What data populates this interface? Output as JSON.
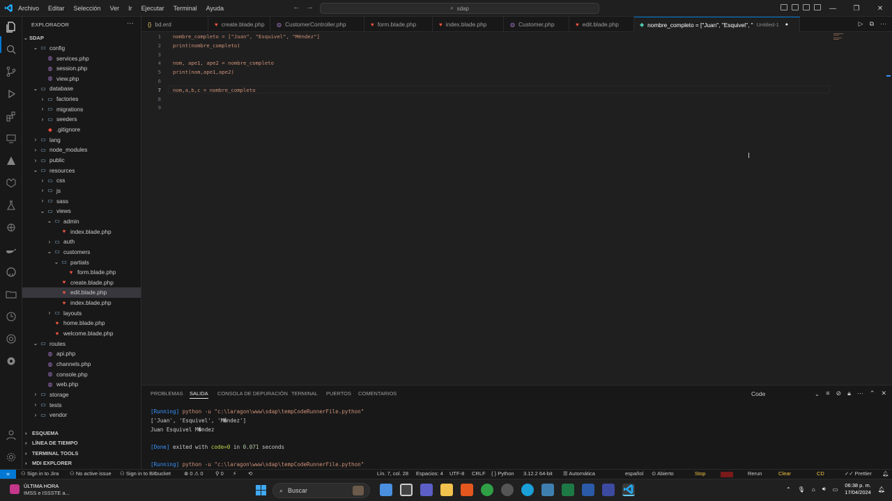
{
  "titlebar": {
    "menu": [
      "Archivo",
      "Editar",
      "Selección",
      "Ver",
      "Ir",
      "Ejecutar",
      "Terminal",
      "Ayuda"
    ],
    "search_text": "sdap"
  },
  "sidebar": {
    "title": "EXPLORADOR",
    "root": "SDAP",
    "tree": [
      {
        "label": "config",
        "depth": 1,
        "kind": "folder",
        "open": true
      },
      {
        "label": "services.php",
        "depth": 2,
        "kind": "php"
      },
      {
        "label": "session.php",
        "depth": 2,
        "kind": "php"
      },
      {
        "label": "view.php",
        "depth": 2,
        "kind": "php"
      },
      {
        "label": "database",
        "depth": 1,
        "kind": "folder",
        "open": true
      },
      {
        "label": "factories",
        "depth": 2,
        "kind": "folder",
        "open": false
      },
      {
        "label": "migrations",
        "depth": 2,
        "kind": "folder",
        "open": false
      },
      {
        "label": "seeders",
        "depth": 2,
        "kind": "folder",
        "open": false
      },
      {
        "label": ".gitignore",
        "depth": 2,
        "kind": "git"
      },
      {
        "label": "lang",
        "depth": 1,
        "kind": "folder",
        "open": false
      },
      {
        "label": "node_modules",
        "depth": 1,
        "kind": "folder",
        "open": false
      },
      {
        "label": "public",
        "depth": 1,
        "kind": "folder",
        "open": false
      },
      {
        "label": "resources",
        "depth": 1,
        "kind": "folder",
        "open": true
      },
      {
        "label": "css",
        "depth": 2,
        "kind": "folder",
        "open": false
      },
      {
        "label": "js",
        "depth": 2,
        "kind": "folder",
        "open": false
      },
      {
        "label": "sass",
        "depth": 2,
        "kind": "folder",
        "open": false
      },
      {
        "label": "views",
        "depth": 2,
        "kind": "folder",
        "open": true
      },
      {
        "label": "admin",
        "depth": 3,
        "kind": "folder",
        "open": true
      },
      {
        "label": "index.blade.php",
        "depth": 4,
        "kind": "blade"
      },
      {
        "label": "auth",
        "depth": 3,
        "kind": "folder",
        "open": false
      },
      {
        "label": "customers",
        "depth": 3,
        "kind": "folder",
        "open": true
      },
      {
        "label": "partials",
        "depth": 4,
        "kind": "folder",
        "open": true
      },
      {
        "label": "form.blade.php",
        "depth": 5,
        "kind": "blade"
      },
      {
        "label": "create.blade.php",
        "depth": 4,
        "kind": "blade"
      },
      {
        "label": "edit.blade.php",
        "depth": 4,
        "kind": "blade",
        "selected": true
      },
      {
        "label": "index.blade.php",
        "depth": 4,
        "kind": "blade"
      },
      {
        "label": "layouts",
        "depth": 3,
        "kind": "folder",
        "open": false
      },
      {
        "label": "home.blade.php",
        "depth": 3,
        "kind": "blade"
      },
      {
        "label": "welcome.blade.php",
        "depth": 3,
        "kind": "blade"
      },
      {
        "label": "routes",
        "depth": 1,
        "kind": "folder",
        "open": true
      },
      {
        "label": "api.php",
        "depth": 2,
        "kind": "php"
      },
      {
        "label": "channels.php",
        "depth": 2,
        "kind": "php"
      },
      {
        "label": "console.php",
        "depth": 2,
        "kind": "php"
      },
      {
        "label": "web.php",
        "depth": 2,
        "kind": "php"
      },
      {
        "label": "storage",
        "depth": 1,
        "kind": "folder",
        "open": false
      },
      {
        "label": "tests",
        "depth": 1,
        "kind": "folder",
        "open": false
      },
      {
        "label": "vendor",
        "depth": 1,
        "kind": "folder",
        "open": false
      }
    ],
    "sections": [
      "ESQUEMA",
      "LÍNEA DE TIEMPO",
      "TERMINAL TOOLS",
      "MDI EXPLORER"
    ]
  },
  "tabs": [
    {
      "label": "bd.erd",
      "icon": "{}"
    },
    {
      "label": "create.blade.php",
      "icon": "blade"
    },
    {
      "label": "CustomerController.php",
      "icon": "php"
    },
    {
      "label": "form.blade.php",
      "icon": "blade"
    },
    {
      "label": "index.blade.php",
      "icon": "blade"
    },
    {
      "label": "Customer.php",
      "icon": "php"
    },
    {
      "label": "edit.blade.php",
      "icon": "blade"
    },
    {
      "label": "nombre_completo = [\"Juan\", \"Esquivel\", \"",
      "suffix": "Untitled-1",
      "icon": "python",
      "active": true
    }
  ],
  "editor": {
    "line_numbers": [
      "1",
      "2",
      "3",
      "4",
      "5",
      "6",
      "7",
      "8",
      "9"
    ],
    "lines": [
      "nombre_completo = [\"Juan\", \"Esquivel\", \"Méndez\"]",
      "print(nombre_completo)",
      "",
      "nom, ape1, ape2 = nombre_completo",
      "print(nom,ape1,ape2)",
      "",
      "nom,a,b,c = nombre_completo",
      "",
      ""
    ]
  },
  "panel": {
    "tabs": [
      "PROBLEMAS",
      "SALIDA",
      "CONSOLA DE DEPURACIÓN",
      "TERMINAL",
      "PUERTOS",
      "COMENTARIOS"
    ],
    "selected_output": "Code",
    "output": {
      "run1_tag": "[Running]",
      "run1_cmd": " python -u \"c:\\laragon\\www\\sdap\\tempCodeRunnerFile.python\"",
      "line2": "['Juan', 'Esquivel', 'M�ndez']",
      "line3": "Juan Esquivel M�ndez",
      "done_tag": "[Done]",
      "done_text": " exited with ",
      "done_code": "code=0",
      "done_in": " in ",
      "done_secs": "0.071",
      "done_unit": " seconds",
      "run2_tag": "[Running]",
      "run2_cmd": " python -u \"c:\\laragon\\www\\sdap\\tempCodeRunnerFile.python\""
    }
  },
  "statusbar": {
    "jira": "Sign in to Jira",
    "issue": "No active issue",
    "bitbucket": "Sign in to Bitbucket",
    "problems": "0 ⚠ 0",
    "ports": "0",
    "position": "Lín. 7, col. 28",
    "spaces": "Espacios: 4",
    "encoding": "UTF-8",
    "eol": "CRLF",
    "language": "Python",
    "version": "3.12.2 64-bit",
    "auto": "Automática",
    "lang": "español",
    "abierto": "Abierto",
    "stop": "Stop",
    "rerun": "Rerun",
    "clear": "Clear",
    "cd": "CD",
    "prettier": "Prettier"
  },
  "taskbar": {
    "news_title": "ÚLTIMA HORA",
    "news_sub": "IMSS e ISSSTE a...",
    "search": "Buscar",
    "time": "06:38 p. m.",
    "date": "17/04/2024"
  },
  "colors": {
    "accent": "#0078d4",
    "string": "#ce9178",
    "blade": "#f05340",
    "php": "#a074c4"
  }
}
